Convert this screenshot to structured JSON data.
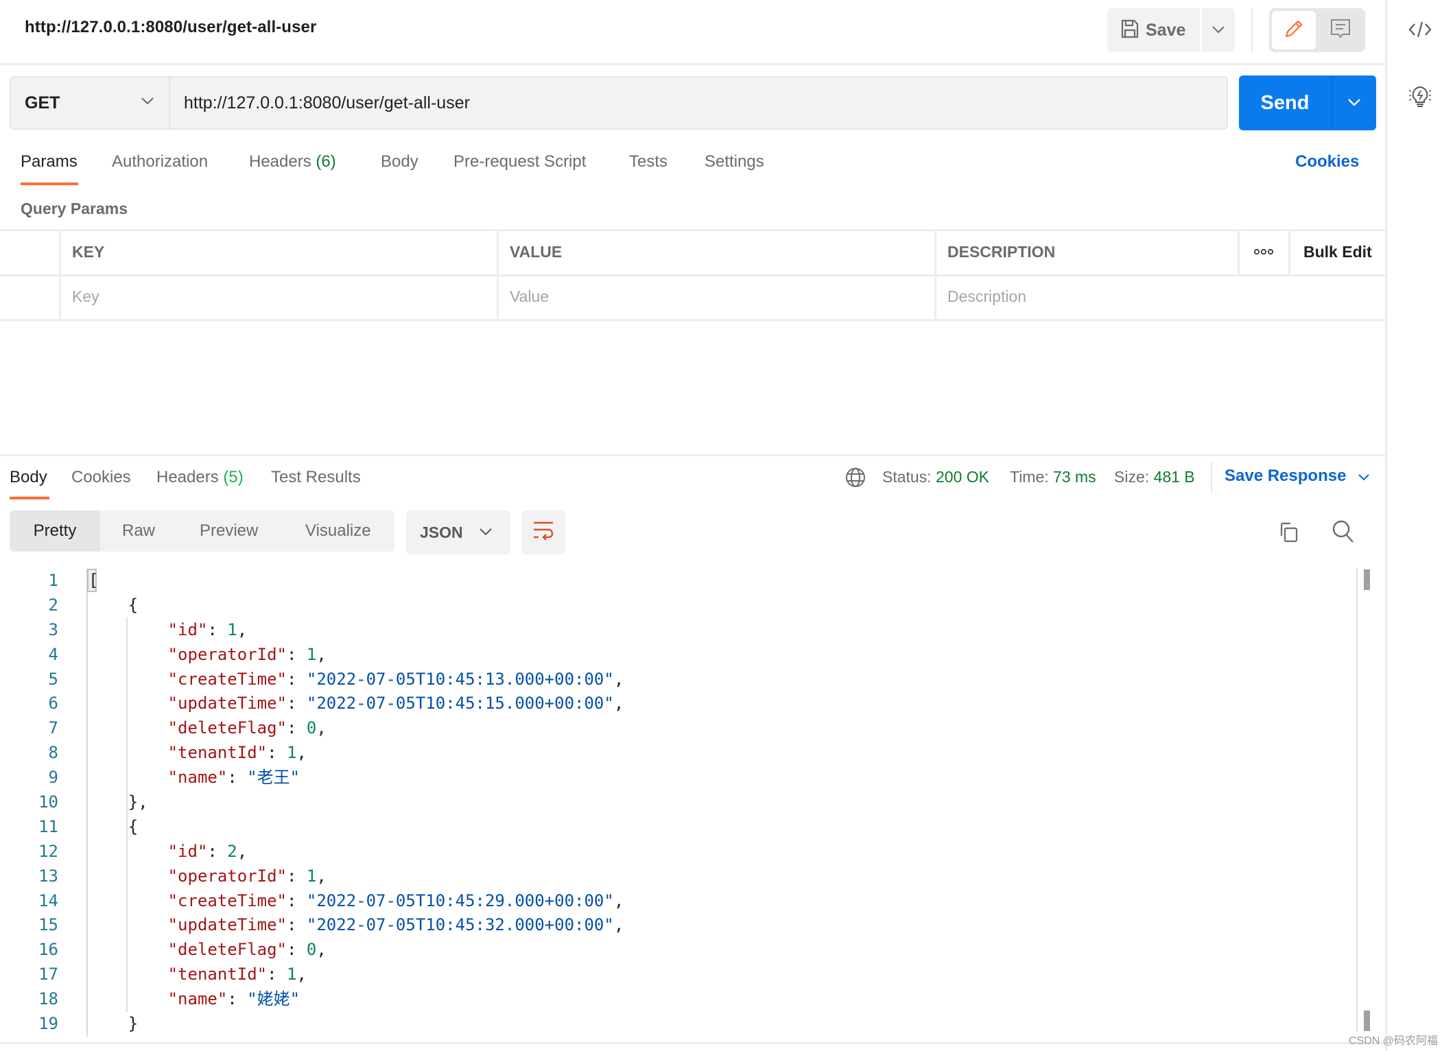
{
  "header": {
    "title": "http://127.0.0.1:8080/user/get-all-user",
    "save_label": "Save",
    "icons": {
      "save": "floppy-disk-icon",
      "save_menu": "chevron-down-icon",
      "edit_mode": "pencil-icon",
      "comment_mode": "comment-icon"
    }
  },
  "right_sidebar": {
    "items": [
      {
        "icon": "code-icon"
      },
      {
        "icon": "lightbulb-icon"
      }
    ]
  },
  "request": {
    "method": "GET",
    "url": "http://127.0.0.1:8080/user/get-all-user",
    "send_label": "Send",
    "tabs": [
      {
        "label": "Params",
        "count": "",
        "active": true
      },
      {
        "label": "Authorization",
        "count": ""
      },
      {
        "label": "Headers",
        "count": "(6)"
      },
      {
        "label": "Body",
        "count": ""
      },
      {
        "label": "Pre-request Script",
        "count": ""
      },
      {
        "label": "Tests",
        "count": ""
      },
      {
        "label": "Settings",
        "count": ""
      }
    ],
    "cookies_label": "Cookies",
    "query_params_label": "Query Params",
    "params_table": {
      "columns": [
        "KEY",
        "VALUE",
        "DESCRIPTION"
      ],
      "placeholders": {
        "key": "Key",
        "value": "Value",
        "description": "Description"
      },
      "bulk_edit_label": "Bulk Edit",
      "more_icon": "more-horizontal-icon"
    }
  },
  "response": {
    "tabs": [
      {
        "label": "Body",
        "count": "",
        "active": true
      },
      {
        "label": "Cookies",
        "count": ""
      },
      {
        "label": "Headers",
        "count": "(5)"
      },
      {
        "label": "Test Results",
        "count": ""
      }
    ],
    "status_label": "Status:",
    "status_value": "200 OK",
    "time_label": "Time:",
    "time_value": "73 ms",
    "size_label": "Size:",
    "size_value": "481 B",
    "save_response_label": "Save Response",
    "view_modes": [
      "Pretty",
      "Raw",
      "Preview",
      "Visualize"
    ],
    "active_view": "Pretty",
    "format": "JSON",
    "colors": {
      "ok": "#0f7b2e",
      "link": "#0b66d0",
      "accent": "#ff6c37",
      "send": "#097bed"
    },
    "code_lines": [
      {
        "n": "1",
        "parts": [
          [
            "p",
            "["
          ]
        ]
      },
      {
        "n": "2",
        "parts": [
          [
            "p",
            "    {"
          ]
        ]
      },
      {
        "n": "3",
        "parts": [
          [
            "p",
            "        "
          ],
          [
            "k",
            "\"id\""
          ],
          [
            "p",
            ": "
          ],
          [
            "n",
            "1"
          ],
          [
            "p",
            ","
          ]
        ]
      },
      {
        "n": "4",
        "parts": [
          [
            "p",
            "        "
          ],
          [
            "k",
            "\"operatorId\""
          ],
          [
            "p",
            ": "
          ],
          [
            "n",
            "1"
          ],
          [
            "p",
            ","
          ]
        ]
      },
      {
        "n": "5",
        "parts": [
          [
            "p",
            "        "
          ],
          [
            "k",
            "\"createTime\""
          ],
          [
            "p",
            ": "
          ],
          [
            "s",
            "\"2022-07-05T10:45:13.000+00:00\""
          ],
          [
            "p",
            ","
          ]
        ]
      },
      {
        "n": "6",
        "parts": [
          [
            "p",
            "        "
          ],
          [
            "k",
            "\"updateTime\""
          ],
          [
            "p",
            ": "
          ],
          [
            "s",
            "\"2022-07-05T10:45:15.000+00:00\""
          ],
          [
            "p",
            ","
          ]
        ]
      },
      {
        "n": "7",
        "parts": [
          [
            "p",
            "        "
          ],
          [
            "k",
            "\"deleteFlag\""
          ],
          [
            "p",
            ": "
          ],
          [
            "n",
            "0"
          ],
          [
            "p",
            ","
          ]
        ]
      },
      {
        "n": "8",
        "parts": [
          [
            "p",
            "        "
          ],
          [
            "k",
            "\"tenantId\""
          ],
          [
            "p",
            ": "
          ],
          [
            "n",
            "1"
          ],
          [
            "p",
            ","
          ]
        ]
      },
      {
        "n": "9",
        "parts": [
          [
            "p",
            "        "
          ],
          [
            "k",
            "\"name\""
          ],
          [
            "p",
            ": "
          ],
          [
            "s",
            "\"老王\""
          ]
        ]
      },
      {
        "n": "10",
        "parts": [
          [
            "p",
            "    },"
          ]
        ]
      },
      {
        "n": "11",
        "parts": [
          [
            "p",
            "    {"
          ]
        ]
      },
      {
        "n": "12",
        "parts": [
          [
            "p",
            "        "
          ],
          [
            "k",
            "\"id\""
          ],
          [
            "p",
            ": "
          ],
          [
            "n",
            "2"
          ],
          [
            "p",
            ","
          ]
        ]
      },
      {
        "n": "13",
        "parts": [
          [
            "p",
            "        "
          ],
          [
            "k",
            "\"operatorId\""
          ],
          [
            "p",
            ": "
          ],
          [
            "n",
            "1"
          ],
          [
            "p",
            ","
          ]
        ]
      },
      {
        "n": "14",
        "parts": [
          [
            "p",
            "        "
          ],
          [
            "k",
            "\"createTime\""
          ],
          [
            "p",
            ": "
          ],
          [
            "s",
            "\"2022-07-05T10:45:29.000+00:00\""
          ],
          [
            "p",
            ","
          ]
        ]
      },
      {
        "n": "15",
        "parts": [
          [
            "p",
            "        "
          ],
          [
            "k",
            "\"updateTime\""
          ],
          [
            "p",
            ": "
          ],
          [
            "s",
            "\"2022-07-05T10:45:32.000+00:00\""
          ],
          [
            "p",
            ","
          ]
        ]
      },
      {
        "n": "16",
        "parts": [
          [
            "p",
            "        "
          ],
          [
            "k",
            "\"deleteFlag\""
          ],
          [
            "p",
            ": "
          ],
          [
            "n",
            "0"
          ],
          [
            "p",
            ","
          ]
        ]
      },
      {
        "n": "17",
        "parts": [
          [
            "p",
            "        "
          ],
          [
            "k",
            "\"tenantId\""
          ],
          [
            "p",
            ": "
          ],
          [
            "n",
            "1"
          ],
          [
            "p",
            ","
          ]
        ]
      },
      {
        "n": "18",
        "parts": [
          [
            "p",
            "        "
          ],
          [
            "k",
            "\"name\""
          ],
          [
            "p",
            ": "
          ],
          [
            "s",
            "\"姥姥\""
          ]
        ]
      },
      {
        "n": "19",
        "parts": [
          [
            "p",
            "    }"
          ]
        ]
      }
    ],
    "icons": {
      "globe": "globe-icon",
      "copy": "copy-icon",
      "search": "search-icon",
      "wrap": "wrap-lines-icon"
    }
  },
  "watermark": "CSDN @码农阿福"
}
